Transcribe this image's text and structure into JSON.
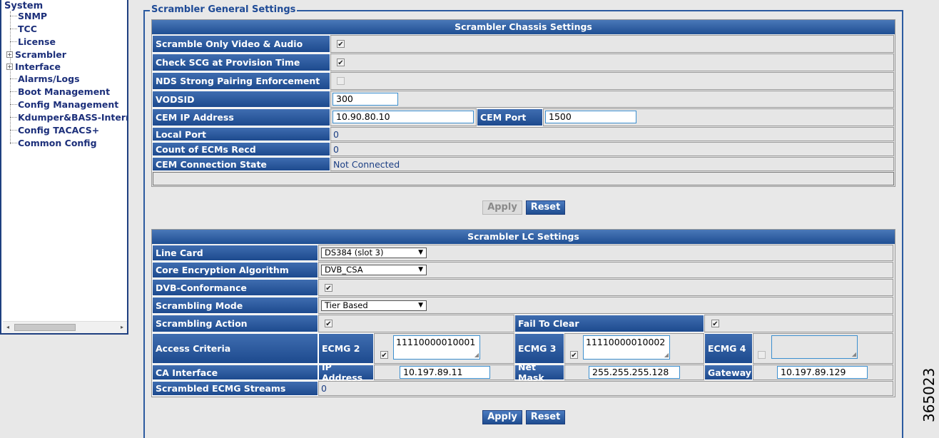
{
  "tree": {
    "root": "System",
    "items": [
      {
        "label": "SNMP",
        "expander": ""
      },
      {
        "label": "TCC",
        "expander": ""
      },
      {
        "label": "License",
        "expander": ""
      },
      {
        "label": "Scrambler",
        "expander": "+"
      },
      {
        "label": "Interface",
        "expander": "+"
      },
      {
        "label": "Alarms/Logs",
        "expander": ""
      },
      {
        "label": "Boot Management",
        "expander": ""
      },
      {
        "label": "Config Management",
        "expander": ""
      },
      {
        "label": "Kdumper&BASS-Interru",
        "expander": ""
      },
      {
        "label": "Config TACACS+",
        "expander": ""
      },
      {
        "label": "Common Config",
        "expander": ""
      }
    ],
    "scroll_left": "◂",
    "scroll_right": "▸"
  },
  "legend": "Scrambler General Settings",
  "chassis": {
    "title": "Scrambler Chassis Settings",
    "scramble_only_label": "Scramble Only Video & Audio",
    "check_scg_label": "Check SCG at Provision Time",
    "nds_label": "NDS Strong Pairing Enforcement",
    "vodsid_label": "VODSID",
    "vodsid_value": "300",
    "cem_ip_label": "CEM IP Address",
    "cem_ip_value": "10.90.80.10",
    "cem_port_label": "CEM Port",
    "cem_port_value": "1500",
    "local_port_label": "Local Port",
    "local_port_value": "0",
    "ecm_count_label": "Count of ECMs Recd",
    "ecm_count_value": "0",
    "cem_state_label": "CEM Connection State",
    "cem_state_value": "Not Connected",
    "check_glyph": "✔"
  },
  "buttons": {
    "apply": "Apply",
    "reset": "Reset"
  },
  "lc": {
    "title": "Scrambler LC Settings",
    "line_card_label": "Line Card",
    "line_card_value": "DS384 (slot 3)",
    "algo_label": "Core Encryption Algorithm",
    "algo_value": "DVB_CSA",
    "dvb_label": "DVB-Conformance",
    "mode_label": "Scrambling Mode",
    "mode_value": "Tier Based",
    "action_label": "Scrambling Action",
    "fail_clear_label": "Fail To Clear",
    "access_label": "Access Criteria",
    "ecmg2_label": "ECMG 2",
    "ecmg2_value": "11110000010001",
    "ecmg3_label": "ECMG 3",
    "ecmg3_value": "11110000010002",
    "ecmg4_label": "ECMG 4",
    "ecmg4_value": "",
    "ca_label": "CA Interface",
    "ip_label": "IP Address",
    "ip_value": "10.197.89.11",
    "mask_label": "Net Mask",
    "mask_value": "255.255.255.128",
    "gw_label": "Gateway",
    "gw_value": "10.197.89.129",
    "streams_label": "Scrambled ECMG Streams",
    "streams_value": "0",
    "caret": "▼"
  },
  "figure_id": "365023",
  "colors": {
    "header_blue": "#1f4f93",
    "label_blue": "#2b5aa0",
    "text_blue": "#1c3f84"
  }
}
